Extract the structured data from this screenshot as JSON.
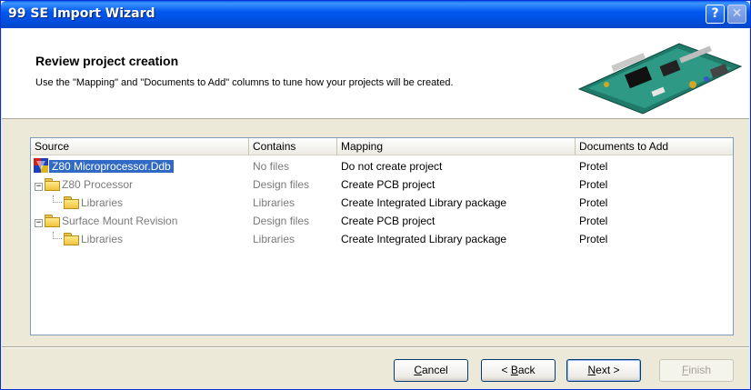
{
  "window": {
    "title": "99 SE Import Wizard",
    "help_label": "?",
    "close_label": "✕"
  },
  "header": {
    "title": "Review project creation",
    "description": "Use the \"Mapping\" and \"Documents to Add\" columns to tune how your projects will be created."
  },
  "table": {
    "columns": [
      "Source",
      "Contains",
      "Mapping",
      "Documents to Add"
    ],
    "rows": [
      {
        "source": "Z80 Microprocessor.Ddb",
        "contains": "No files",
        "mapping": "Do not create project",
        "documents": "Protel",
        "icon": "database-icon",
        "selected": true
      },
      {
        "source": "Z80 Processor",
        "contains": "Design files",
        "mapping": "Create PCB project",
        "documents": "Protel",
        "icon": "folder-icon",
        "expander": "−"
      },
      {
        "source": "Libraries",
        "contains": "Libraries",
        "mapping": "Create Integrated Library package",
        "documents": "Protel",
        "icon": "folder-icon"
      },
      {
        "source": "Surface Mount Revision",
        "contains": "Design files",
        "mapping": "Create PCB project",
        "documents": "Protel",
        "icon": "folder-icon",
        "expander": "−"
      },
      {
        "source": "Libraries",
        "contains": "Libraries",
        "mapping": "Create Integrated Library package",
        "documents": "Protel",
        "icon": "folder-icon"
      }
    ]
  },
  "buttons": {
    "cancel": {
      "pre": "",
      "key": "C",
      "post": "ancel"
    },
    "back": {
      "pre": "< ",
      "key": "B",
      "post": "ack"
    },
    "next": {
      "pre": "",
      "key": "N",
      "post": "ext >"
    },
    "finish": {
      "pre": "",
      "key": "F",
      "post": "inish"
    }
  },
  "colors": {
    "titlebar": "#0058ee",
    "selection": "#316ac5",
    "header_bg": "#ffffff"
  }
}
